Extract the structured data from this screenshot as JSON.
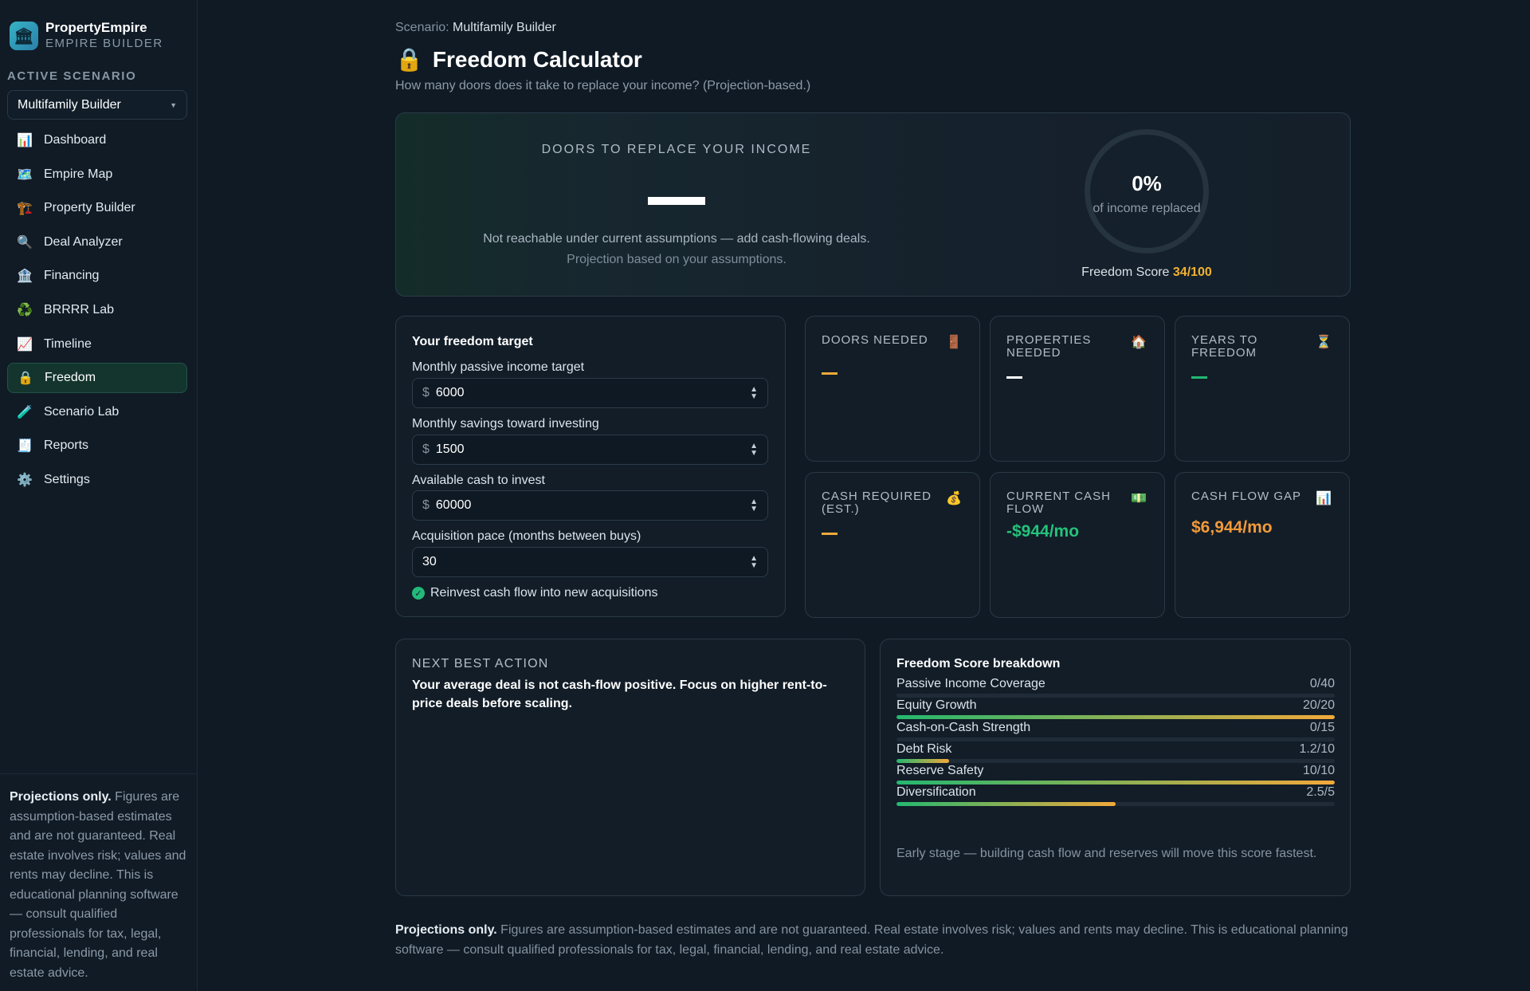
{
  "app": {
    "name": "PropertyEmpire",
    "subtitle": "EMPIRE BUILDER"
  },
  "sidebar": {
    "section_label": "ACTIVE SCENARIO",
    "scenario_selected": "Multifamily Builder",
    "items": [
      {
        "label": "Dashboard",
        "icon": "📊"
      },
      {
        "label": "Empire Map",
        "icon": "🗺️"
      },
      {
        "label": "Property Builder",
        "icon": "🏗️"
      },
      {
        "label": "Deal Analyzer",
        "icon": "🔍"
      },
      {
        "label": "Financing",
        "icon": "🏦"
      },
      {
        "label": "BRRRR Lab",
        "icon": "♻️"
      },
      {
        "label": "Timeline",
        "icon": "📈"
      },
      {
        "label": "Freedom",
        "icon": "🔒"
      },
      {
        "label": "Scenario Lab",
        "icon": "🧪"
      },
      {
        "label": "Reports",
        "icon": "🧾"
      },
      {
        "label": "Settings",
        "icon": "⚙️"
      }
    ],
    "active_item": "Freedom",
    "footer_bold": "Projections only.",
    "footer_text": " Figures are assumption-based estimates and are not guaranteed. Real estate involves risk; values and rents may decline. This is educational planning software — consult qualified professionals for tax, legal, financial, lending, and real estate advice."
  },
  "header": {
    "breadcrumb_label": "Scenario:",
    "breadcrumb_value": "Multifamily Builder",
    "title_icon": "🔒",
    "title": "Freedom Calculator",
    "subtitle": "How many doors does it take to replace your income? (Projection-based.)"
  },
  "hero": {
    "label": "DOORS TO REPLACE YOUR INCOME",
    "message": "Not reachable under current assumptions — add cash-flowing deals.",
    "note": "Projection based on your assumptions.",
    "income_replaced_pct": "0%",
    "income_replaced_label": "of income replaced",
    "freedom_score_label": "Freedom Score",
    "freedom_score_value": "34/100"
  },
  "target": {
    "title": "Your freedom target",
    "fields": [
      {
        "label": "Monthly passive income target",
        "currency": "$",
        "value": "6000"
      },
      {
        "label": "Monthly savings toward investing",
        "currency": "$",
        "value": "1500"
      },
      {
        "label": "Available cash to invest",
        "currency": "$",
        "value": "60000"
      },
      {
        "label": "Acquisition pace (months between buys)",
        "currency": "",
        "value": "30"
      }
    ],
    "reinvest_label": "Reinvest cash flow into new acquisitions",
    "reinvest_checked": true
  },
  "metrics": [
    {
      "label": "DOORS NEEDED",
      "icon": "🚪",
      "value": "",
      "dash_color": "#f2a93a"
    },
    {
      "label": "PROPERTIES NEEDED",
      "icon": "🏠",
      "value": "",
      "dash_color": "#ffffff"
    },
    {
      "label": "YEARS TO FREEDOM",
      "icon": "⏳",
      "value": "",
      "dash_color": "#24b86f"
    },
    {
      "label": "CASH REQUIRED (EST.)",
      "icon": "💰",
      "value": "",
      "dash_color": "#f2a93a"
    },
    {
      "label": "CURRENT CASH FLOW",
      "icon": "💵",
      "value": "-$944/mo",
      "value_color": "#24c27a"
    },
    {
      "label": "CASH FLOW GAP",
      "icon": "📊",
      "value": "$6,944/mo",
      "value_color": "#f29a3a"
    }
  ],
  "next_best_action": {
    "label": "NEXT BEST ACTION",
    "text": "Your average deal is not cash-flow positive. Focus on higher rent-to-price deals before scaling."
  },
  "breakdown": {
    "title": "Freedom Score breakdown",
    "rows": [
      {
        "label": "Passive Income Coverage",
        "value": "0/40",
        "fraction": 0
      },
      {
        "label": "Equity Growth",
        "value": "20/20",
        "fraction": 1
      },
      {
        "label": "Cash-on-Cash Strength",
        "value": "0/15",
        "fraction": 0
      },
      {
        "label": "Debt Risk",
        "value": "1.2/10",
        "fraction": 0.12
      },
      {
        "label": "Reserve Safety",
        "value": "10/10",
        "fraction": 1
      },
      {
        "label": "Diversification",
        "value": "2.5/5",
        "fraction": 0.5
      }
    ],
    "note": "Early stage — building cash flow and reserves will move this score fastest."
  },
  "disclaimer": {
    "bold": "Projections only.",
    "text": " Figures are assumption-based estimates and are not guaranteed. Real estate involves risk; values and rents may decline. This is educational planning software — consult qualified professionals for tax, legal, financial, lending, and real estate advice."
  },
  "colors": {
    "accent_green": "#24b86f",
    "accent_orange": "#f2a93a",
    "score_yellow": "#f2b233"
  }
}
